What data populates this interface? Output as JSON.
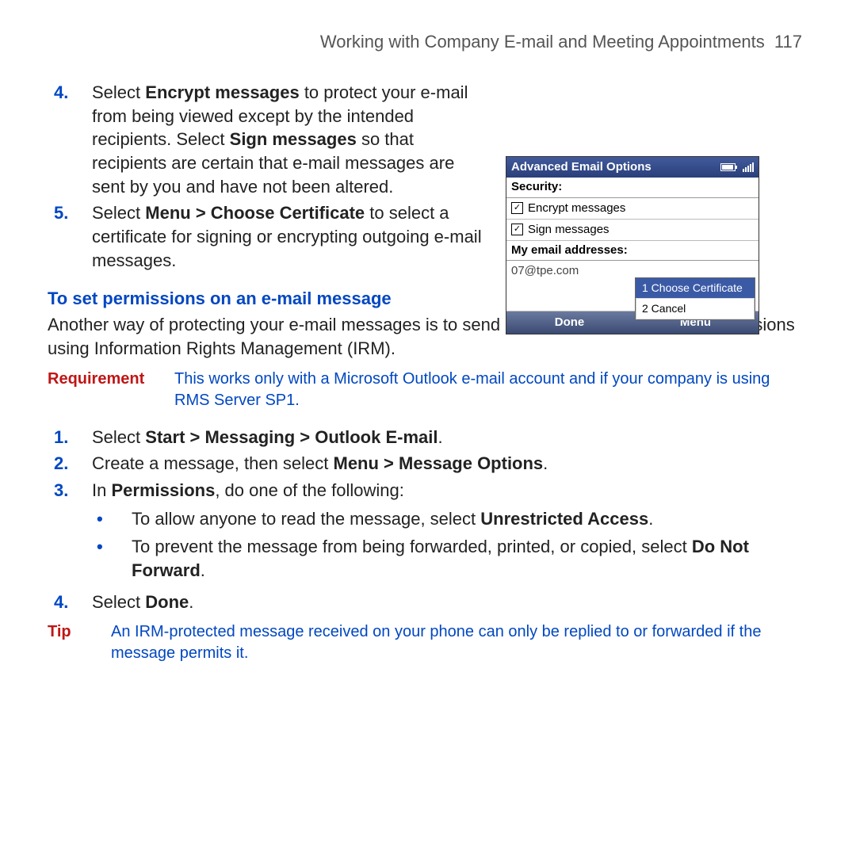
{
  "header": {
    "title": "Working with Company E-mail and Meeting Appointments",
    "page_number": "117"
  },
  "steps_top": [
    {
      "num": "4.",
      "segments": [
        {
          "t": "Select "
        },
        {
          "t": "Encrypt messages",
          "b": true
        },
        {
          "t": " to protect your e-mail from being viewed except by the intended recipients. Select "
        },
        {
          "t": "Sign messages",
          "b": true
        },
        {
          "t": " so that recipients are certain that e-mail messages are sent by you and have not been altered."
        }
      ]
    },
    {
      "num": "5.",
      "segments": [
        {
          "t": "Select "
        },
        {
          "t": "Menu > Choose Certificate",
          "b": true
        },
        {
          "t": " to select a certificate for signing or encrypting outgoing e-mail messages."
        }
      ]
    }
  ],
  "section_title": "To set permissions on an e-mail message",
  "section_intro": "Another way of protecting your e-mail messages is to send messages with restricted permissions using Information Rights Management (IRM).",
  "requirement": {
    "label": "Requirement",
    "text": "This works only with a Microsoft Outlook e-mail account and if your company is using RMS Server SP1."
  },
  "steps_mid": [
    {
      "num": "1.",
      "segments": [
        {
          "t": "Select "
        },
        {
          "t": "Start > Messaging > Outlook E-mail",
          "b": true
        },
        {
          "t": "."
        }
      ]
    },
    {
      "num": "2.",
      "segments": [
        {
          "t": "Create a message, then select "
        },
        {
          "t": "Menu > Message Options",
          "b": true
        },
        {
          "t": "."
        }
      ]
    },
    {
      "num": "3.",
      "segments": [
        {
          "t": "In "
        },
        {
          "t": "Permissions",
          "b": true
        },
        {
          "t": ", do one of the following:"
        }
      ]
    }
  ],
  "bullets": [
    {
      "segments": [
        {
          "t": "To allow anyone to read the message, select "
        },
        {
          "t": "Unrestricted Access",
          "b": true
        },
        {
          "t": "."
        }
      ]
    },
    {
      "segments": [
        {
          "t": "To prevent the message from being forwarded, printed, or copied, select "
        },
        {
          "t": "Do Not Forward",
          "b": true
        },
        {
          "t": "."
        }
      ]
    }
  ],
  "steps_bot": [
    {
      "num": "4.",
      "segments": [
        {
          "t": "Select "
        },
        {
          "t": "Done",
          "b": true
        },
        {
          "t": "."
        }
      ]
    }
  ],
  "tip": {
    "label": "Tip",
    "text": "An IRM-protected message received on your phone can only be replied to or forwarded if the message permits it."
  },
  "phone": {
    "title": "Advanced Email Options",
    "security_label": "Security:",
    "encrypt_label": "Encrypt messages",
    "sign_label": "Sign messages",
    "addresses_label": "My email addresses:",
    "email": "07@tpe.com",
    "menu_choose": "1 Choose Certificate",
    "menu_cancel": "2 Cancel",
    "soft_left": "Done",
    "soft_right": "Menu"
  }
}
